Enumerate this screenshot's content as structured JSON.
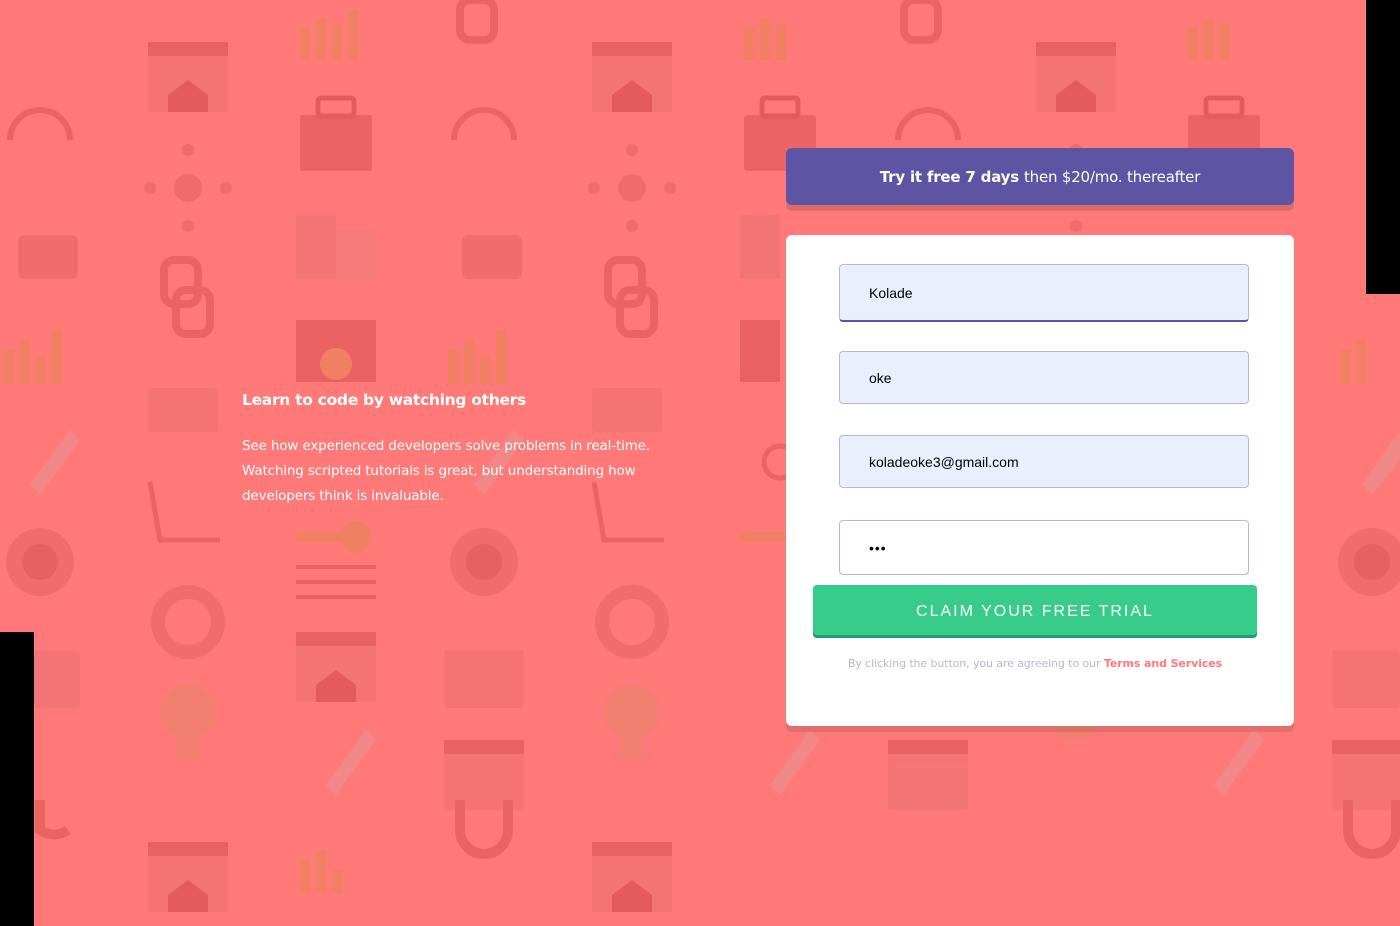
{
  "colors": {
    "background": "#ff7979",
    "banner": "#5e54a4",
    "card": "#ffffff",
    "field_autofill": "#e8f0fe",
    "cta": "#38cc8b",
    "terms_link": "#ff7979",
    "muted_text": "#b9b6d3"
  },
  "intro": {
    "heading": "Learn to code by watching others",
    "body": "See how experienced developers solve problems in real-time. Watching scripted tutorials is great, but understanding how developers think is invaluable."
  },
  "banner": {
    "bold": "Try it free 7 days",
    "rest": "then $20/mo. thereafter"
  },
  "form": {
    "first_name": {
      "value": "Kolade"
    },
    "last_name": {
      "value": "oke"
    },
    "email": {
      "value": "koladeoke3@gmail.com"
    },
    "password": {
      "value": "•••"
    },
    "submit_label": "Claim your free trial",
    "terms_prefix": "By clicking the button, you are agreeing to our",
    "terms_link": "Terms and Services"
  },
  "background_icons": [
    "browser-window-icon",
    "toolbox-icon",
    "headset-icon",
    "network-icon",
    "thumbs-up-icon",
    "documents-icon",
    "link-icon",
    "bar-chart-icon",
    "gear-folder-icon",
    "rocket-icon",
    "globe-icon",
    "life-ring-icon",
    "calendar-icon",
    "lightbulb-icon",
    "magnet-icon",
    "sitemap-icon",
    "key-icon"
  ]
}
